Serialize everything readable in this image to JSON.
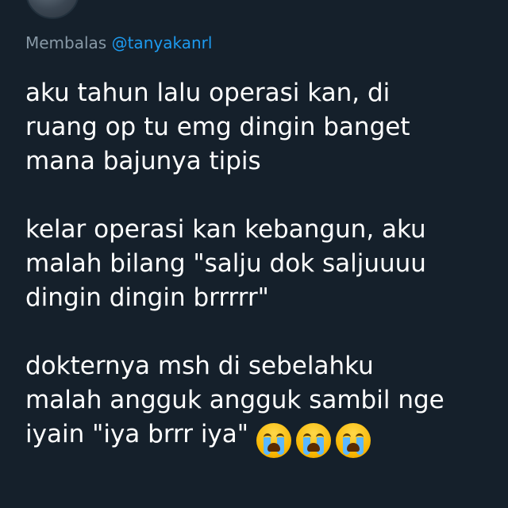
{
  "reply": {
    "prefix": "Membalas",
    "handle": "@tanyakanrl"
  },
  "tweet": {
    "paragraphs": [
      "aku tahun lalu operasi kan, di\nruang op tu emg dingin banget\nmana bajunya tipis",
      "kelar operasi kan kebangun, aku\nmalah bilang \"salju dok saljuuuu\ndingin dingin brrrrr\"",
      "dokternya msh di sebelahku\nmalah angguk angguk sambil nge\niyain \"iya brrr iya\""
    ],
    "emojis": [
      "loudly-crying-face",
      "loudly-crying-face",
      "loudly-crying-face"
    ]
  },
  "colors": {
    "background": "#15202b",
    "text": "#ffffff",
    "muted": "#8899a6",
    "link": "#1d9bf0"
  }
}
